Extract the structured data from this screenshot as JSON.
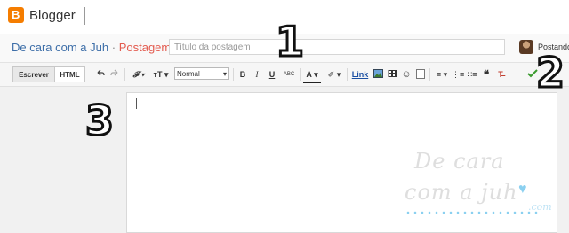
{
  "app": {
    "logo_letter": "B",
    "brand": "Blogger"
  },
  "titlebar": {
    "blog_name": "De cara com a Juh",
    "separator": "·",
    "page": "Postagem",
    "title_placeholder": "Título da postagem",
    "status": "Postando"
  },
  "toolbar": {
    "tab_write": "Escrever",
    "tab_html": "HTML",
    "font_label": "𝓕 ▾",
    "size_label": "тT ▾",
    "format_value": "Normal",
    "bold": "B",
    "italic": "I",
    "underline": "U",
    "strike": "ABC",
    "text_color": "A ▾",
    "highlight": "✐ ▾",
    "link": "Link",
    "emoji": "☺",
    "align": "≡ ▾",
    "numbered_list": "⋮≡",
    "bulleted_list": "∷≡",
    "quote": "❝",
    "clear_format": "T̶"
  },
  "annotations": {
    "one": "1",
    "two": "2",
    "three": "3"
  },
  "watermark": {
    "line1": "De cara",
    "line2": "com a juh",
    "suffix": ".com"
  }
}
